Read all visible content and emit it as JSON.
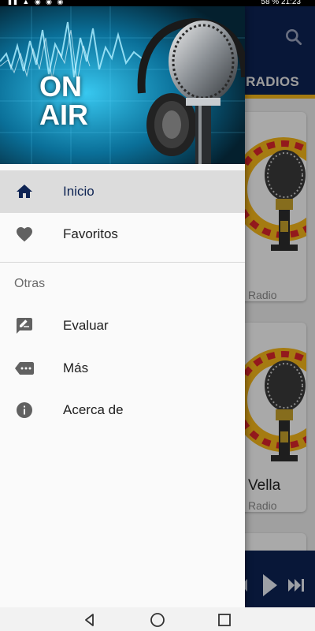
{
  "status_bar": {
    "left_icons": "▮▮ ▲ ◉ ◉ ◉",
    "battery": "58 %",
    "time": "21:23"
  },
  "app": {
    "tab_label": "S RADIOS",
    "cards": [
      {
        "title": "",
        "subtitle": "Radio"
      },
      {
        "title": "Vella",
        "subtitle": "Radio"
      }
    ],
    "colors": {
      "primary": "#0d2353",
      "accent": "#f3b51a"
    }
  },
  "drawer": {
    "header": {
      "line1": "ON",
      "line2": "AIR"
    },
    "items": [
      {
        "label": "Inicio",
        "icon": "home-icon",
        "selected": true
      },
      {
        "label": "Favoritos",
        "icon": "heart-icon"
      }
    ],
    "section_title": "Otras",
    "other_items": [
      {
        "label": "Evaluar",
        "icon": "rate-review-icon"
      },
      {
        "label": "Más",
        "icon": "more-icon"
      },
      {
        "label": "Acerca de",
        "icon": "info-icon"
      }
    ]
  },
  "nav_bar": {
    "buttons": [
      "back-icon",
      "home-icon",
      "recent-apps-icon"
    ]
  }
}
